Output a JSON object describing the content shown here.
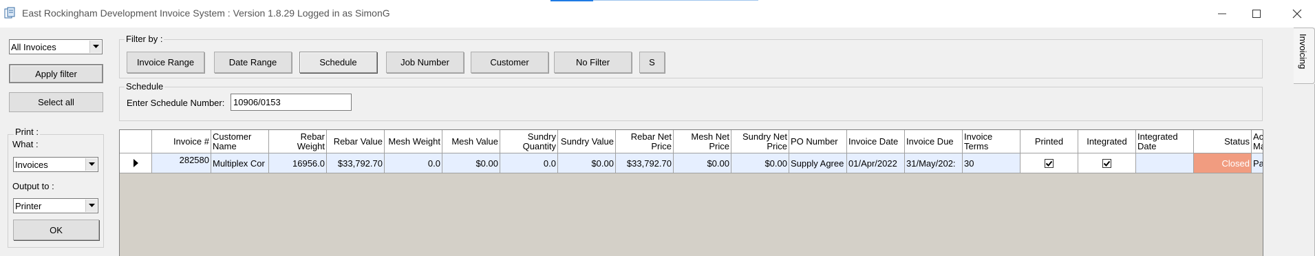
{
  "window": {
    "title": "East Rockingham Development Invoice System : Version 1.8.29 Logged in as SimonG",
    "minimize_icon": "minimize-icon",
    "maximize_icon": "maximize-icon",
    "close_icon": "close-icon"
  },
  "left_panel": {
    "invoice_type_selected": "All Invoices",
    "apply_filter_label": "Apply filter",
    "select_all_label": "Select all",
    "print_group_label": "Print :",
    "what_label": "What :",
    "what_selected": "Invoices",
    "output_to_label": "Output to :",
    "output_selected": "Printer",
    "ok_label": "OK"
  },
  "filter": {
    "group_label": "Filter by :",
    "buttons": [
      "Invoice Range",
      "Date Range",
      "Schedule",
      "Job Number",
      "Customer",
      "No Filter",
      "S"
    ],
    "active": "Schedule"
  },
  "schedule": {
    "group_label": "Schedule",
    "prompt": "Enter Schedule Number:",
    "value": "10906/0153"
  },
  "grid": {
    "columns": [
      "Invoice #",
      "Customer Name",
      "Rebar Weight",
      "Rebar Value",
      "Mesh Weight",
      "Mesh Value",
      "Sundry Quantity",
      "Sundry Value",
      "Rebar Net Price",
      "Mesh Net Price",
      "Sundry Net Price",
      "PO Number",
      "Invoice Date",
      "Invoice Due",
      "Invoice Terms",
      "Printed",
      "Integrated",
      "Integrated Date",
      "Status",
      "Acc Ma"
    ],
    "rows": [
      {
        "invoice_no": "282580",
        "customer": "Multiplex Cor",
        "rebar_weight": "16956.0",
        "rebar_value": "$33,792.70",
        "mesh_weight": "0.0",
        "mesh_value": "$0.00",
        "sundry_qty": "0.0",
        "sundry_value": "$0.00",
        "rebar_net": "$33,792.70",
        "mesh_net": "$0.00",
        "sundry_net": "$0.00",
        "po_number": "Supply Agree",
        "invoice_date": "01/Apr/2022",
        "invoice_due": "31/May/202:",
        "invoice_terms": "30",
        "printed": true,
        "integrated": true,
        "integrated_date": "",
        "status": "Closed",
        "acc_ma": "Pa"
      }
    ]
  },
  "side_tab": {
    "label": "Invoicing"
  },
  "colors": {
    "status_closed": "#f19c80",
    "row_selected": "#e6efff",
    "grid_empty": "#d4d0c8",
    "accent": "#1e7be4"
  }
}
